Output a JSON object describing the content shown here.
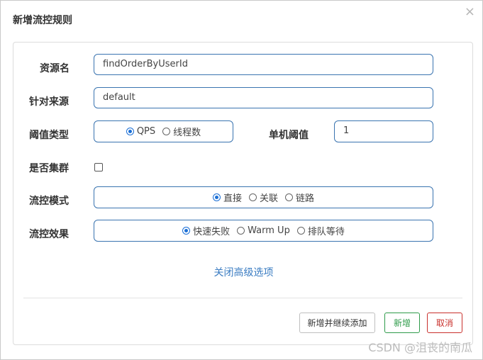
{
  "dialog": {
    "title": "新增流控规则",
    "close_label": "×"
  },
  "form": {
    "resource_name": {
      "label": "资源名",
      "value": "findOrderByUserId"
    },
    "limit_app": {
      "label": "针对来源",
      "value": "default"
    },
    "grade": {
      "label": "阈值类型",
      "options": [
        "QPS",
        "线程数"
      ],
      "selected": "QPS"
    },
    "threshold": {
      "label": "单机阈值",
      "value": "1"
    },
    "cluster": {
      "label": "是否集群",
      "checked": false
    },
    "strategy": {
      "label": "流控模式",
      "options": [
        "直接",
        "关联",
        "链路"
      ],
      "selected": "直接"
    },
    "control_behavior": {
      "label": "流控效果",
      "options": [
        "快速失败",
        "Warm Up",
        "排队等待"
      ],
      "selected": "快速失败"
    },
    "advanced_toggle": "关闭高级选项"
  },
  "buttons": {
    "add_and_continue": "新增并继续添加",
    "add": "新增",
    "cancel": "取消"
  },
  "watermark": "CSDN @沮丧的南瓜"
}
